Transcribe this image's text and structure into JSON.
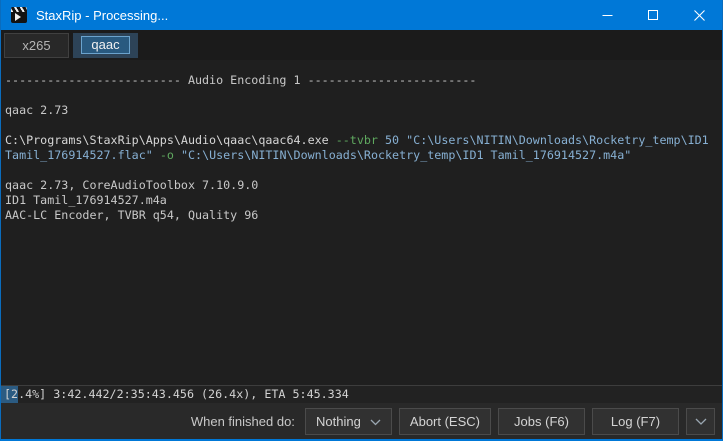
{
  "window": {
    "title": "StaxRip - Processing..."
  },
  "tabs": [
    {
      "label": "x265",
      "selected": false
    },
    {
      "label": "qaac",
      "selected": true
    }
  ],
  "console": {
    "header_line": "------------------------- Audio Encoding 1 ------------------------",
    "version_line": "qaac 2.73",
    "command": {
      "exe": "C:\\Programs\\StaxRip\\Apps\\Audio\\qaac\\qaac64.exe",
      "flag_tvbr": "--tvbr",
      "tvbr_value": "50",
      "input_path_start": "\"C:\\Users\\NITIN\\Downloads\\Rocketry_temp\\ID1",
      "input_path_end": "Tamil_176914527.flac\"",
      "flag_output": "-o",
      "output_path": "\"C:\\Users\\NITIN\\Downloads\\Rocketry_temp\\ID1 Tamil_176914527.m4a\""
    },
    "info_lines": [
      "qaac 2.73, CoreAudioToolbox 7.10.9.0",
      "ID1 Tamil_176914527.m4a",
      "AAC-LC Encoder, TVBR q54, Quality 96"
    ]
  },
  "status": {
    "text": "[2.4%] 3:42.442/2:35:43.456 (26.4x), ETA 5:45.334",
    "progress_percent": 2.4
  },
  "bottom_bar": {
    "label": "When finished do:",
    "dropdown_value": "Nothing",
    "buttons": [
      "Abort (ESC)",
      "Jobs (F6)",
      "Log (F7)"
    ]
  },
  "colors": {
    "titlebar_accent": "#0078d7",
    "console_background": "#1f1f1f",
    "command_flag_green": "#5fa85f",
    "command_string_blue": "#87b0d3",
    "progress_fill_blue": "#2b5b82",
    "selected_tab_border_blue": "#6ba3cd",
    "selected_tab_fill": "#295a80"
  }
}
